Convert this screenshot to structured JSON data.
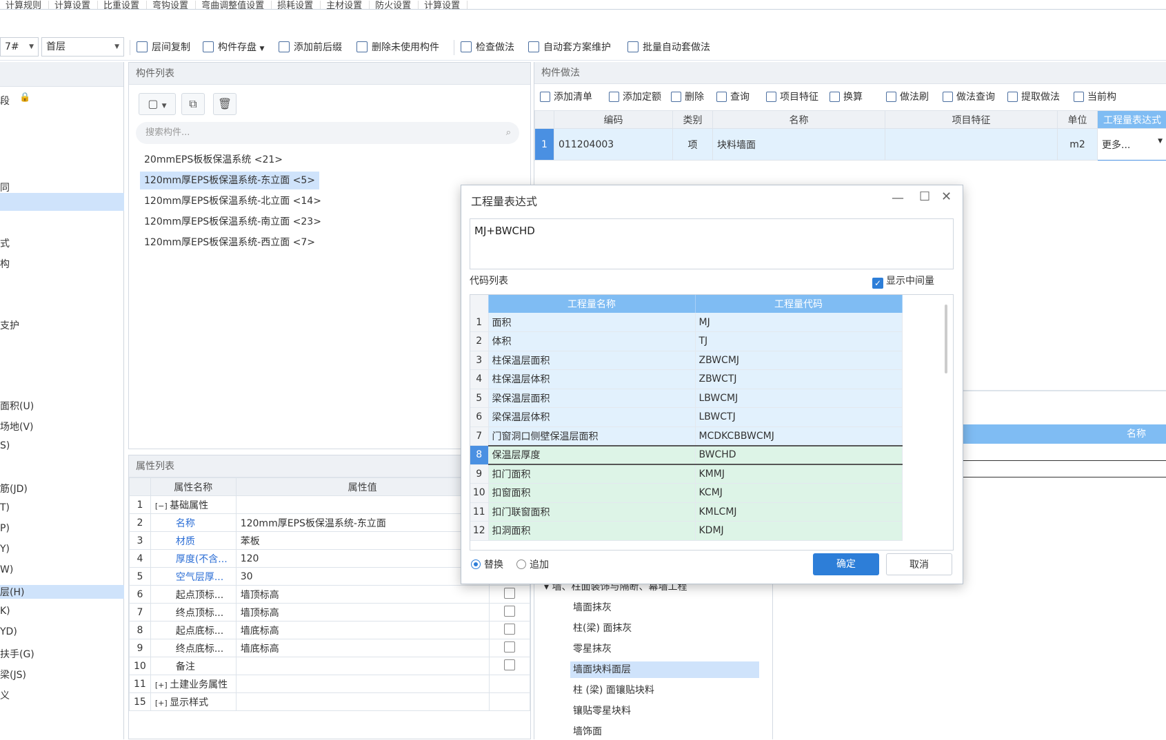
{
  "menu": [
    "计算规则",
    "计算设置",
    "比重设置",
    "弯钩设置",
    "弯曲调整值设置",
    "损耗设置",
    "主材设置",
    "防火设置",
    "计算设置"
  ],
  "toolbar": {
    "combo1": "7#",
    "combo2": "首层",
    "buttons": [
      "层间复制",
      "构件存盘",
      "添加前后缀",
      "删除未使用构件",
      "检查做法",
      "自动套方案维护",
      "批量自动套做法"
    ]
  },
  "left_items": [
    "段",
    "同",
    "式",
    "构",
    "支护",
    "面积(U)",
    "场地(V)",
    "S)",
    "筋(JD)",
    "T)",
    "P)",
    "Y)",
    "W)",
    "层(H)",
    "K)",
    "YD)",
    "扶手(G)",
    "梁(JS)",
    "义"
  ],
  "component_panel": {
    "title": "构件列表",
    "search_placeholder": "搜索构件...",
    "items": [
      "20mmEPS板板保温系统 <21>",
      "120mm厚EPS板保温系统-东立面 <5>",
      "120mm厚EPS板保温系统-北立面 <14>",
      "120mm厚EPS板保温系统-南立面 <23>",
      "120mm厚EPS板保温系统-西立面 <7>"
    ]
  },
  "property_panel": {
    "title": "属性列表",
    "headers": [
      "属性名称",
      "属性值"
    ],
    "rows": [
      {
        "n": "1",
        "name": "基础属性",
        "value": "",
        "sign": "−"
      },
      {
        "n": "2",
        "name": "名称",
        "value": "120mm厚EPS板保温系统-东立面"
      },
      {
        "n": "3",
        "name": "材质",
        "value": "苯板"
      },
      {
        "n": "4",
        "name": "厚度(不含...",
        "value": "120"
      },
      {
        "n": "5",
        "name": "空气层厚...",
        "value": "30"
      },
      {
        "n": "6",
        "name": "起点顶标...",
        "value": "墙顶标高"
      },
      {
        "n": "7",
        "name": "终点顶标...",
        "value": "墙顶标高"
      },
      {
        "n": "8",
        "name": "起点底标...",
        "value": "墙底标高"
      },
      {
        "n": "9",
        "name": "终点底标...",
        "value": "墙底标高"
      },
      {
        "n": "10",
        "name": "备注",
        "value": ""
      },
      {
        "n": "11",
        "name": "土建业务属性",
        "value": "",
        "sign": "+"
      },
      {
        "n": "15",
        "name": "显示样式",
        "value": "",
        "sign": "+"
      }
    ]
  },
  "method_panel": {
    "title": "构件做法",
    "toolbar": [
      "添加清单",
      "添加定额",
      "删除",
      "查询",
      "项目特征",
      "换算",
      "做法刷",
      "做法查询",
      "提取做法",
      "当前构"
    ],
    "headers": [
      "编码",
      "类别",
      "名称",
      "项目特征",
      "单位",
      "工程量表达式"
    ],
    "row": {
      "n": "1",
      "code": "011204003",
      "type": "项",
      "name": "块料墙面",
      "feature": "",
      "unit": "m2",
      "expr": "更多..."
    },
    "lower_header": "名称",
    "tree_root": "墙、柱面装饰与隔断、幕墙工程",
    "tree": [
      "墙面抹灰",
      "柱(梁) 面抹灰",
      "零星抹灰",
      "墙面块料面层",
      "柱 (梁) 面镶贴块料",
      "镶贴零星块料",
      "墙饰面"
    ]
  },
  "dialog": {
    "title": "工程量表达式",
    "expression": "MJ+BWCHD",
    "code_list_label": "代码列表",
    "show_intermediate": "显示中间量",
    "headers": [
      "工程量名称",
      "工程量代码"
    ],
    "rows": [
      {
        "n": "1",
        "name": "面积",
        "code": "MJ"
      },
      {
        "n": "2",
        "name": "体积",
        "code": "TJ"
      },
      {
        "n": "3",
        "name": "柱保温层面积",
        "code": "ZBWCMJ"
      },
      {
        "n": "4",
        "name": "柱保温层体积",
        "code": "ZBWCTJ"
      },
      {
        "n": "5",
        "name": "梁保温层面积",
        "code": "LBWCMJ"
      },
      {
        "n": "6",
        "name": "梁保温层体积",
        "code": "LBWCTJ"
      },
      {
        "n": "7",
        "name": "门窗洞口侧壁保温层面积",
        "code": "MCDKCBBWCMJ"
      },
      {
        "n": "8",
        "name": "保温层厚度",
        "code": "BWCHD"
      },
      {
        "n": "9",
        "name": "扣门面积",
        "code": "KMMJ"
      },
      {
        "n": "10",
        "name": "扣窗面积",
        "code": "KCMJ"
      },
      {
        "n": "11",
        "name": "扣门联窗面积",
        "code": "KMLCMJ"
      },
      {
        "n": "12",
        "name": "扣洞面积",
        "code": "KDMJ"
      }
    ],
    "replace": "替换",
    "append": "追加",
    "ok": "确定",
    "cancel": "取消"
  }
}
